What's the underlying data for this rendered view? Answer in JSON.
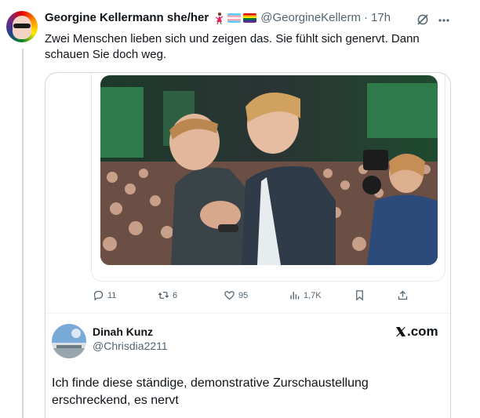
{
  "tweet": {
    "author_name": "Georgine Kellermann she/her",
    "author_emojis": [
      "dancer",
      "transgender-flag",
      "rainbow-flag"
    ],
    "handle": "@GeorgineKellerm",
    "separator": "·",
    "time": "17h",
    "text": "Zwei Menschen lieben sich und zeigen das. Sie fühlt sich genervt. Dann schauen Sie doch weg."
  },
  "quoted_post": {
    "stats": {
      "replies": "11",
      "reposts": "6",
      "likes": "95",
      "views": "1,7K"
    }
  },
  "embedded_reply": {
    "name": "Dinah Kunz",
    "handle": "@Chrisdia2211",
    "brand": ".com",
    "text": "Ich finde diese ständige, demonstrative Zurschaustellung erschreckend, es nervt"
  },
  "icons": [
    "grok-icon",
    "more-icon",
    "reply-icon",
    "repost-icon",
    "like-icon",
    "views-icon",
    "bookmark-icon",
    "share-icon",
    "x-logo-icon"
  ],
  "colors": {
    "text": "#0f1419",
    "secondary": "#536471",
    "border": "#cfd9de"
  }
}
